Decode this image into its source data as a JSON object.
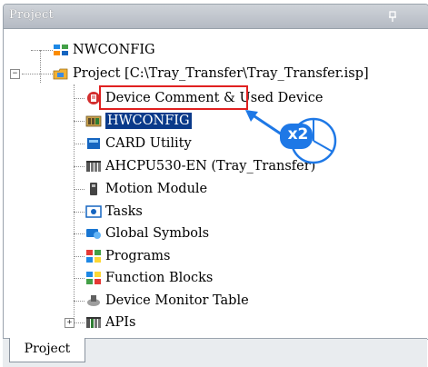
{
  "panel": {
    "title": "Project"
  },
  "tree": {
    "items": [
      {
        "label": "NWCONFIG",
        "icon": "nwconfig-icon"
      },
      {
        "label": "Project [C:\\Tray_Transfer\\Tray_Transfer.isp]",
        "icon": "project-icon"
      },
      {
        "label": "Device Comment & Used Device",
        "icon": "device-comment-icon"
      },
      {
        "label": "HWCONFIG",
        "icon": "hwconfig-icon",
        "selected": true
      },
      {
        "label": "CARD Utility",
        "icon": "card-utility-icon"
      },
      {
        "label": "AHCPU530-EN  (Tray_Transfer)",
        "icon": "cpu-icon"
      },
      {
        "label": "Motion Module",
        "icon": "motion-module-icon"
      },
      {
        "label": "Tasks",
        "icon": "tasks-icon"
      },
      {
        "label": "Global Symbols",
        "icon": "global-symbols-icon"
      },
      {
        "label": "Programs",
        "icon": "programs-icon"
      },
      {
        "label": "Function Blocks",
        "icon": "function-blocks-icon"
      },
      {
        "label": "Device Monitor Table",
        "icon": "device-monitor-icon"
      },
      {
        "label": "APIs",
        "icon": "apis-icon"
      }
    ]
  },
  "callout": {
    "badge_text": "x2",
    "action": "double-click"
  },
  "tabs": [
    {
      "label": "Project",
      "active": true
    }
  ],
  "colors": {
    "selection": "#0a3a8a",
    "highlight_box": "#e02020",
    "callout_blue": "#1e78e6"
  }
}
